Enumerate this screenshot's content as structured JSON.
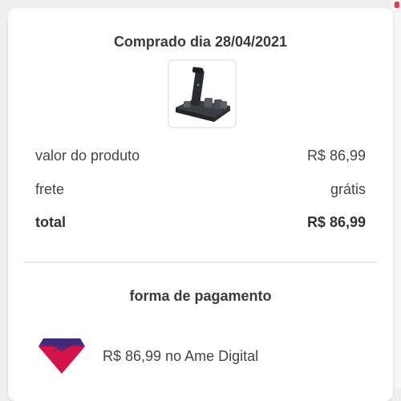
{
  "order": {
    "title": "Comprado dia 28/04/2021",
    "product_icon": "hair-trimmer-product-image"
  },
  "summary": {
    "rows": [
      {
        "label": "valor do produto",
        "value": "R$ 86,99"
      },
      {
        "label": "frete",
        "value": "grátis"
      },
      {
        "label": "total",
        "value": "R$ 86,99"
      }
    ]
  },
  "payment": {
    "section_title": "forma de pagamento",
    "method_text": "R$ 86,99 no Ame Digital",
    "logo_icon": "ame-digital-logo",
    "logo_colors": {
      "top": "#3f2a7a",
      "bottom": "#d2134a"
    }
  }
}
